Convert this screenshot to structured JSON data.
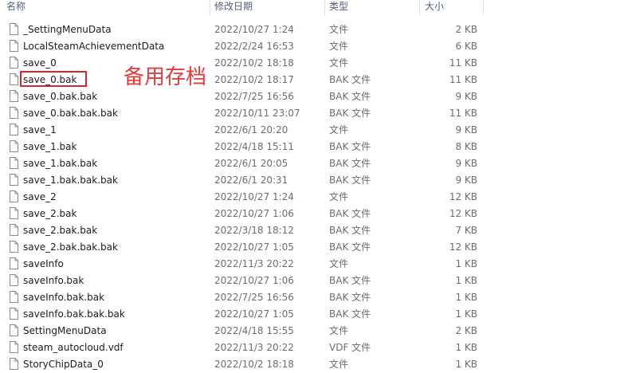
{
  "columns": {
    "name": "名称",
    "date": "修改日期",
    "type": "类型",
    "size": "大小"
  },
  "annotation": "备用存档",
  "highlight_color": "#d9262a",
  "files": [
    {
      "name": "_SettingMenuData",
      "date": "2022/10/27 1:24",
      "type": "文件",
      "size": "2 KB"
    },
    {
      "name": "LocalSteamAchievementData",
      "date": "2022/2/24 16:53",
      "type": "文件",
      "size": "6 KB"
    },
    {
      "name": "save_0",
      "date": "2022/10/2 18:18",
      "type": "文件",
      "size": "11 KB"
    },
    {
      "name": "save_0.bak",
      "date": "2022/10/2 18:17",
      "type": "BAK 文件",
      "size": "11 KB"
    },
    {
      "name": "save_0.bak.bak",
      "date": "2022/7/25 16:56",
      "type": "BAK 文件",
      "size": "9 KB"
    },
    {
      "name": "save_0.bak.bak.bak",
      "date": "2022/10/11 23:07",
      "type": "BAK 文件",
      "size": "11 KB"
    },
    {
      "name": "save_1",
      "date": "2022/6/1 20:20",
      "type": "文件",
      "size": "9 KB"
    },
    {
      "name": "save_1.bak",
      "date": "2022/4/18 15:11",
      "type": "BAK 文件",
      "size": "8 KB"
    },
    {
      "name": "save_1.bak.bak",
      "date": "2022/6/1 20:05",
      "type": "BAK 文件",
      "size": "9 KB"
    },
    {
      "name": "save_1.bak.bak.bak",
      "date": "2022/6/1 20:31",
      "type": "BAK 文件",
      "size": "9 KB"
    },
    {
      "name": "save_2",
      "date": "2022/10/27 1:24",
      "type": "文件",
      "size": "12 KB"
    },
    {
      "name": "save_2.bak",
      "date": "2022/10/27 1:06",
      "type": "BAK 文件",
      "size": "12 KB"
    },
    {
      "name": "save_2.bak.bak",
      "date": "2022/3/18 18:12",
      "type": "BAK 文件",
      "size": "7 KB"
    },
    {
      "name": "save_2.bak.bak.bak",
      "date": "2022/10/27 1:05",
      "type": "BAK 文件",
      "size": "12 KB"
    },
    {
      "name": "saveInfo",
      "date": "2022/11/3 20:22",
      "type": "文件",
      "size": "1 KB"
    },
    {
      "name": "saveInfo.bak",
      "date": "2022/10/27 1:06",
      "type": "BAK 文件",
      "size": "1 KB"
    },
    {
      "name": "saveInfo.bak.bak",
      "date": "2022/7/25 16:56",
      "type": "BAK 文件",
      "size": "1 KB"
    },
    {
      "name": "saveInfo.bak.bak.bak",
      "date": "2022/10/27 1:05",
      "type": "BAK 文件",
      "size": "1 KB"
    },
    {
      "name": "SettingMenuData",
      "date": "2022/4/18 15:55",
      "type": "文件",
      "size": "2 KB"
    },
    {
      "name": "steam_autocloud.vdf",
      "date": "2022/11/3 20:22",
      "type": "VDF 文件",
      "size": "1 KB"
    },
    {
      "name": "StoryChipData_0",
      "date": "2022/10/2 18:18",
      "type": "文件",
      "size": "1 KB"
    }
  ]
}
